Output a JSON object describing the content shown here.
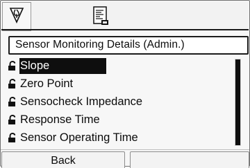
{
  "window": {
    "title": "Sensor Monitoring Details (Admin.)"
  },
  "status_bar": {
    "left_icon": "measurement-symbol-icon",
    "center_icon": "document-icon"
  },
  "menu": {
    "items": [
      {
        "label": "Slope",
        "selected": true,
        "icon": "lock-icon"
      },
      {
        "label": "Zero Point",
        "selected": false,
        "icon": "lock-icon"
      },
      {
        "label": "Sensocheck Impedance",
        "selected": false,
        "icon": "lock-icon"
      },
      {
        "label": "Response Time",
        "selected": false,
        "icon": "lock-icon"
      },
      {
        "label": "Sensor Operating Time",
        "selected": false,
        "icon": "lock-icon"
      }
    ]
  },
  "softkeys": {
    "left_label": "Back",
    "right_label": ""
  },
  "colors": {
    "selection_bg": "#0e0e0e",
    "selection_text": "#ffffff",
    "text": "#0b0b0b"
  }
}
